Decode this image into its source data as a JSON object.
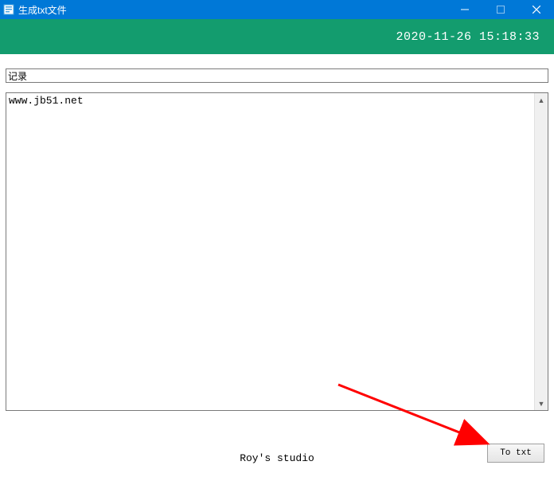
{
  "window": {
    "title": "生成txt文件"
  },
  "banner": {
    "timestamp": "2020-11-26 15:18:33"
  },
  "form": {
    "title_input": "记录",
    "content_textarea": "www.jb51.net"
  },
  "footer": {
    "studio_label": "Roy's studio",
    "button_label": "To txt"
  }
}
